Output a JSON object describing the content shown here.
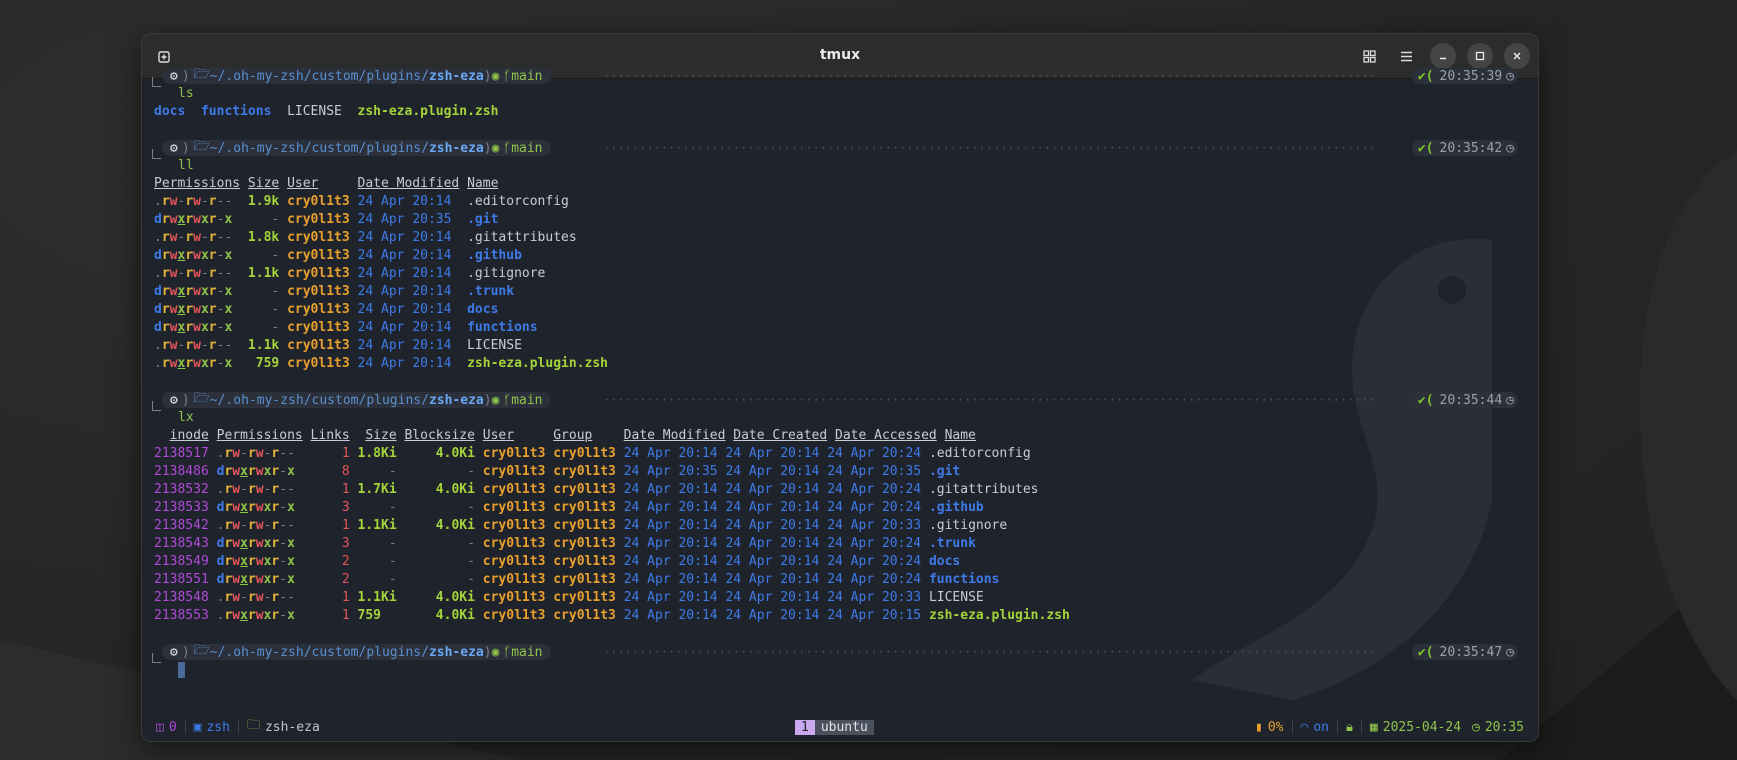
{
  "window": {
    "title": "tmux"
  },
  "prompt": {
    "path_dim": "~/.oh-my-zsh/custom/plugins/",
    "path_bold": "zsh-eza",
    "branch": "main"
  },
  "blocks": [
    {
      "time": "20:35:39",
      "cmd": "ls"
    },
    {
      "time": "20:35:42",
      "cmd": "ll"
    },
    {
      "time": "20:35:44",
      "cmd": "lx"
    },
    {
      "time": "20:35:47",
      "cmd": ""
    }
  ],
  "ls_output": [
    {
      "name": "docs",
      "kind": "dir"
    },
    {
      "name": "functions",
      "kind": "dir"
    },
    {
      "name": "LICENSE",
      "kind": "plain"
    },
    {
      "name": "zsh-eza.plugin.zsh",
      "kind": "exe"
    }
  ],
  "ll": {
    "headers": [
      "Permissions",
      "Size",
      "User",
      "Date Modified",
      "Name"
    ],
    "rows": [
      {
        "perm": ".rw-rw-r--",
        "size": "1.9k",
        "user": "cry0l1t3",
        "date": "24 Apr 20:14",
        "name": ".editorconfig",
        "kind": "plain"
      },
      {
        "perm": "drwxrwxr-x",
        "size": "-",
        "user": "cry0l1t3",
        "date": "24 Apr 20:35",
        "name": ".git",
        "kind": "dir"
      },
      {
        "perm": ".rw-rw-r--",
        "size": "1.8k",
        "user": "cry0l1t3",
        "date": "24 Apr 20:14",
        "name": ".gitattributes",
        "kind": "plain"
      },
      {
        "perm": "drwxrwxr-x",
        "size": "-",
        "user": "cry0l1t3",
        "date": "24 Apr 20:14",
        "name": ".github",
        "kind": "dir"
      },
      {
        "perm": ".rw-rw-r--",
        "size": "1.1k",
        "user": "cry0l1t3",
        "date": "24 Apr 20:14",
        "name": ".gitignore",
        "kind": "plain"
      },
      {
        "perm": "drwxrwxr-x",
        "size": "-",
        "user": "cry0l1t3",
        "date": "24 Apr 20:14",
        "name": ".trunk",
        "kind": "dir"
      },
      {
        "perm": "drwxrwxr-x",
        "size": "-",
        "user": "cry0l1t3",
        "date": "24 Apr 20:14",
        "name": "docs",
        "kind": "dir"
      },
      {
        "perm": "drwxrwxr-x",
        "size": "-",
        "user": "cry0l1t3",
        "date": "24 Apr 20:14",
        "name": "functions",
        "kind": "dir"
      },
      {
        "perm": ".rw-rw-r--",
        "size": "1.1k",
        "user": "cry0l1t3",
        "date": "24 Apr 20:14",
        "name": "LICENSE",
        "kind": "plain"
      },
      {
        "perm": ".rwxrwxr-x",
        "size": "759",
        "user": "cry0l1t3",
        "date": "24 Apr 20:14",
        "name": "zsh-eza.plugin.zsh",
        "kind": "exe"
      }
    ]
  },
  "lx": {
    "headers": [
      "inode",
      "Permissions",
      "Links",
      "Size",
      "Blocksize",
      "User",
      "Group",
      "Date Modified",
      "Date Created",
      "Date Accessed",
      "Name"
    ],
    "rows": [
      {
        "inode": "2138517",
        "perm": ".rw-rw-r--",
        "links": "1",
        "size": "1.8Ki",
        "blk": "4.0Ki",
        "user": "cry0l1t3",
        "group": "cry0l1t3",
        "mod": "24 Apr 20:14",
        "cre": "24 Apr 20:14",
        "acc": "24 Apr 20:24",
        "name": ".editorconfig",
        "kind": "plain"
      },
      {
        "inode": "2138486",
        "perm": "drwxrwxr-x",
        "links": "8",
        "size": "-",
        "blk": "-",
        "user": "cry0l1t3",
        "group": "cry0l1t3",
        "mod": "24 Apr 20:35",
        "cre": "24 Apr 20:14",
        "acc": "24 Apr 20:35",
        "name": ".git",
        "kind": "dir"
      },
      {
        "inode": "2138532",
        "perm": ".rw-rw-r--",
        "links": "1",
        "size": "1.7Ki",
        "blk": "4.0Ki",
        "user": "cry0l1t3",
        "group": "cry0l1t3",
        "mod": "24 Apr 20:14",
        "cre": "24 Apr 20:14",
        "acc": "24 Apr 20:24",
        "name": ".gitattributes",
        "kind": "plain"
      },
      {
        "inode": "2138533",
        "perm": "drwxrwxr-x",
        "links": "3",
        "size": "-",
        "blk": "-",
        "user": "cry0l1t3",
        "group": "cry0l1t3",
        "mod": "24 Apr 20:14",
        "cre": "24 Apr 20:14",
        "acc": "24 Apr 20:24",
        "name": ".github",
        "kind": "dir"
      },
      {
        "inode": "2138542",
        "perm": ".rw-rw-r--",
        "links": "1",
        "size": "1.1Ki",
        "blk": "4.0Ki",
        "user": "cry0l1t3",
        "group": "cry0l1t3",
        "mod": "24 Apr 20:14",
        "cre": "24 Apr 20:14",
        "acc": "24 Apr 20:33",
        "name": ".gitignore",
        "kind": "plain"
      },
      {
        "inode": "2138543",
        "perm": "drwxrwxr-x",
        "links": "3",
        "size": "-",
        "blk": "-",
        "user": "cry0l1t3",
        "group": "cry0l1t3",
        "mod": "24 Apr 20:14",
        "cre": "24 Apr 20:14",
        "acc": "24 Apr 20:24",
        "name": ".trunk",
        "kind": "dir"
      },
      {
        "inode": "2138549",
        "perm": "drwxrwxr-x",
        "links": "2",
        "size": "-",
        "blk": "-",
        "user": "cry0l1t3",
        "group": "cry0l1t3",
        "mod": "24 Apr 20:14",
        "cre": "24 Apr 20:14",
        "acc": "24 Apr 20:24",
        "name": "docs",
        "kind": "dir"
      },
      {
        "inode": "2138551",
        "perm": "drwxrwxr-x",
        "links": "2",
        "size": "-",
        "blk": "-",
        "user": "cry0l1t3",
        "group": "cry0l1t3",
        "mod": "24 Apr 20:14",
        "cre": "24 Apr 20:14",
        "acc": "24 Apr 20:24",
        "name": "functions",
        "kind": "dir"
      },
      {
        "inode": "2138548",
        "perm": ".rw-rw-r--",
        "links": "1",
        "size": "1.1Ki",
        "blk": "4.0Ki",
        "user": "cry0l1t3",
        "group": "cry0l1t3",
        "mod": "24 Apr 20:14",
        "cre": "24 Apr 20:14",
        "acc": "24 Apr 20:33",
        "name": "LICENSE",
        "kind": "plain"
      },
      {
        "inode": "2138553",
        "perm": ".rwxrwxr-x",
        "links": "1",
        "size": "759",
        "blk": "4.0Ki",
        "user": "cry0l1t3",
        "group": "cry0l1t3",
        "mod": "24 Apr 20:14",
        "cre": "24 Apr 20:14",
        "acc": "24 Apr 20:15",
        "name": "zsh-eza.plugin.zsh",
        "kind": "exe"
      }
    ]
  },
  "statusbar": {
    "session": "0",
    "shell": "zsh",
    "dir": "zsh-eza",
    "window_index": "1",
    "window_name": "ubuntu",
    "battery": "0%",
    "wifi": "on",
    "date": "2025-04-24",
    "time": "20:35"
  },
  "colors": {
    "dir": "#3e7be8",
    "exe": "#a4d43a",
    "user": "#e8a02e",
    "inode": "#b04ad8",
    "active_window": "#c9a8f0"
  }
}
